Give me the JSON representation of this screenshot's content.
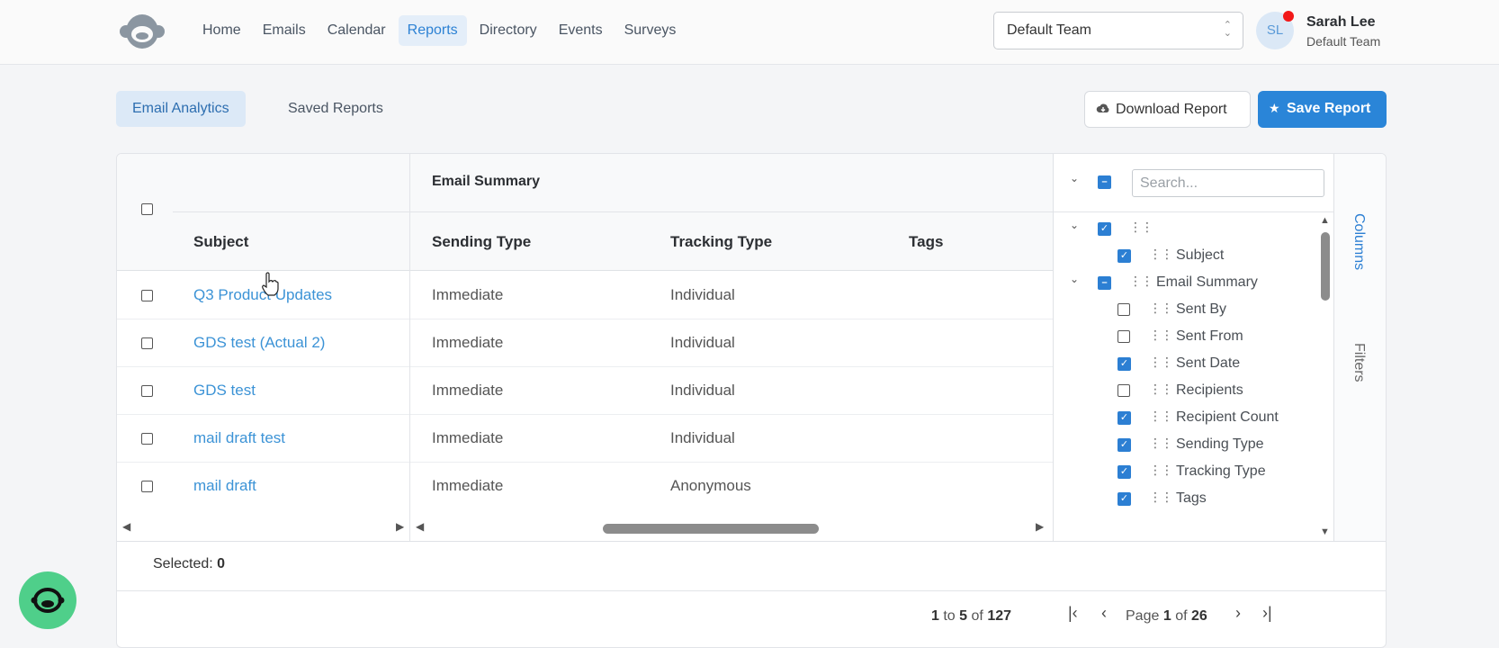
{
  "nav": {
    "items": [
      {
        "label": "Home",
        "active": false
      },
      {
        "label": "Emails",
        "active": false
      },
      {
        "label": "Calendar",
        "active": false
      },
      {
        "label": "Reports",
        "active": true
      },
      {
        "label": "Directory",
        "active": false
      },
      {
        "label": "Events",
        "active": false
      },
      {
        "label": "Surveys",
        "active": false
      }
    ],
    "team_select": "Default Team",
    "user": {
      "initials": "SL",
      "name": "Sarah Lee",
      "team": "Default Team"
    }
  },
  "subtabs": {
    "email_analytics": "Email Analytics",
    "saved_reports": "Saved Reports"
  },
  "actions": {
    "download": "Download Report",
    "save": "Save Report"
  },
  "grid": {
    "group_title": "Email Summary",
    "columns": {
      "subject": "Subject",
      "sending_type": "Sending Type",
      "tracking_type": "Tracking Type",
      "tags": "Tags"
    },
    "rows": [
      {
        "subject": "Q3 Product Updates",
        "sending_type": "Immediate",
        "tracking_type": "Individual",
        "tags": ""
      },
      {
        "subject": "GDS test (Actual 2)",
        "sending_type": "Immediate",
        "tracking_type": "Individual",
        "tags": ""
      },
      {
        "subject": "GDS test",
        "sending_type": "Immediate",
        "tracking_type": "Individual",
        "tags": ""
      },
      {
        "subject": "mail draft test",
        "sending_type": "Immediate",
        "tracking_type": "Individual",
        "tags": ""
      },
      {
        "subject": "mail draft",
        "sending_type": "Immediate",
        "tracking_type": "Anonymous",
        "tags": ""
      }
    ],
    "selected_label": "Selected:",
    "selected_count": "0",
    "pagination": {
      "from": "1",
      "to_word": "to",
      "to": "5",
      "of_word": "of",
      "total": "127",
      "page_word": "Page",
      "page": "1",
      "page_of": "of",
      "pages": "26"
    }
  },
  "column_panel": {
    "search_placeholder": "Search...",
    "items": [
      {
        "label": "Subject",
        "checked": true
      },
      {
        "label": "Email Summary",
        "checked": "partial"
      },
      {
        "label": "Sent By",
        "checked": false
      },
      {
        "label": "Sent From",
        "checked": false
      },
      {
        "label": "Sent Date",
        "checked": true
      },
      {
        "label": "Recipients",
        "checked": false
      },
      {
        "label": "Recipient Count",
        "checked": true
      },
      {
        "label": "Sending Type",
        "checked": true
      },
      {
        "label": "Tracking Type",
        "checked": true
      },
      {
        "label": "Tags",
        "checked": true
      }
    ],
    "side_tabs": {
      "columns": "Columns",
      "filters": "Filters"
    }
  },
  "colors": {
    "accent": "#2a85d8",
    "link": "#3c93d6",
    "fab": "#4fcf8a",
    "notification": "#f21818"
  }
}
